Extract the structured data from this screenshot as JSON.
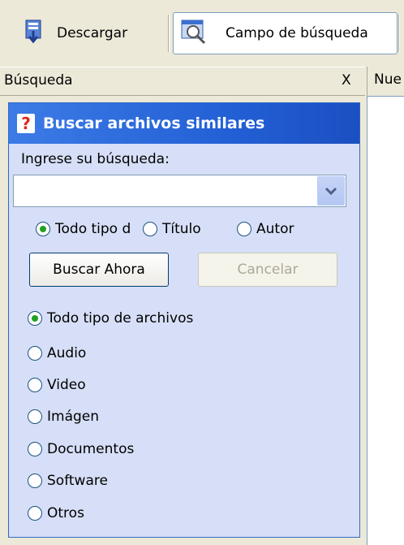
{
  "toolbar": {
    "download_label": "Descargar",
    "search_field_label": "Campo de búsqueda"
  },
  "panel": {
    "title": "Búsqueda",
    "close_label": "X",
    "right_tab_label": "Nue"
  },
  "task": {
    "header_title": "Buscar archivos similares",
    "help_glyph": "?",
    "search_prompt": "Ingrese su búsqueda:",
    "search_value": "",
    "scope_options": [
      {
        "label": "Todo tipo de archivos",
        "checked": true
      },
      {
        "label": "Título",
        "checked": false
      },
      {
        "label": "Autor",
        "checked": false
      }
    ],
    "scope_visible": {
      "first": "Todo tipo d",
      "second": "Título"
    },
    "buttons": {
      "search": "Buscar Ahora",
      "cancel": "Cancelar"
    },
    "type_options": [
      {
        "label": "Todo tipo de archivos",
        "checked": true
      },
      {
        "label": "Audio",
        "checked": false
      },
      {
        "label": "Video",
        "checked": false
      },
      {
        "label": "Imágen",
        "checked": false
      },
      {
        "label": "Documentos",
        "checked": false
      },
      {
        "label": "Software",
        "checked": false
      },
      {
        "label": "Otros",
        "checked": false
      }
    ]
  },
  "colors": {
    "task_background": "#d6dff7",
    "header_blue": "#2361d6",
    "radio_selected": "#21a121"
  }
}
